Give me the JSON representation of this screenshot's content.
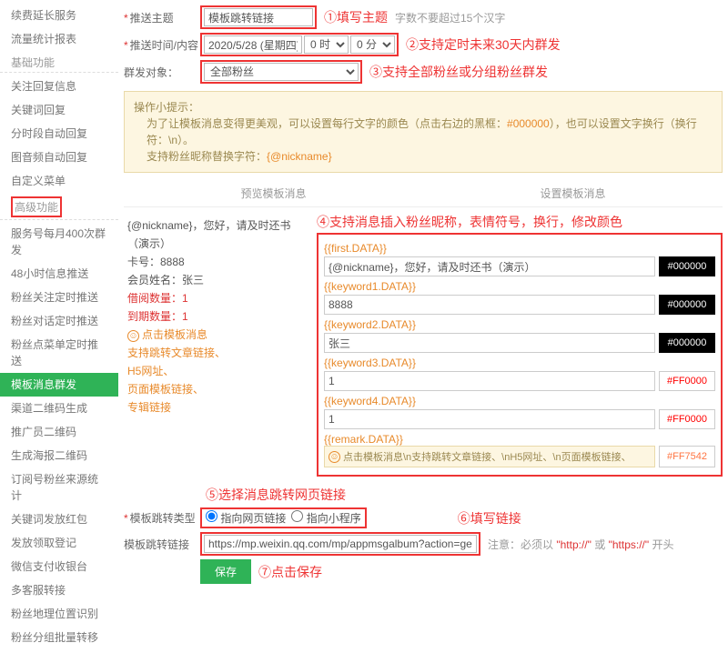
{
  "sidebar": {
    "groups": [
      {
        "title": "",
        "items": [
          "续费延长服务",
          "流量统计报表"
        ]
      },
      {
        "title": "基础功能",
        "items": [
          "关注回复信息",
          "关键词回复",
          "分时段自动回复",
          "图音频自动回复",
          "自定义菜单"
        ]
      },
      {
        "title": "高级功能",
        "items": [
          "服务号每月400次群发",
          "48小时信息推送",
          "粉丝关注定时推送",
          "粉丝对话定时推送",
          "粉丝点菜单定时推送",
          "模板消息群发",
          "渠道二维码生成",
          "推广员二维码",
          "生成海报二维码",
          "订阅号粉丝来源统计",
          "关键词发放红包",
          "发放领取登记",
          "微信支付收银台",
          "多客服转接",
          "粉丝地理位置识别",
          "粉丝分组批量转移"
        ],
        "activeIndex": 5,
        "boxedTitle": true
      }
    ]
  },
  "form": {
    "subject": {
      "label": "推送主题",
      "value": "模板跳转链接",
      "hint": "字数不要超过15个汉字"
    },
    "time": {
      "label": "推送时间/内容",
      "date": "2020/5/28 (星期四)",
      "hour": "0 时",
      "min": "0 分"
    },
    "target": {
      "label": "群发对象",
      "value": "全部粉丝"
    },
    "ann1": "①填写主题",
    "ann2": "②支持定时未来30天内群发",
    "ann3": "③支持全部粉丝或分组粉丝群发"
  },
  "tips": {
    "title": "操作小提示：",
    "l1_a": "为了让模板消息变得更美观，可以设置每行文字的颜色（点击右边的黑框：",
    "l1_b": "#000000",
    "l1_c": "），也可以设置文字换行（换行符：\\n）。",
    "l2_a": "支持粉丝昵称替换字符：",
    "l2_b": "{@nickname}"
  },
  "tabs": {
    "t1": "预览模板消息",
    "t2": "设置模板消息"
  },
  "preview": {
    "l1": "{@nickname}，您好，请及时还书（演示）",
    "l2": "卡号：8888",
    "l3": "会员姓名：张三",
    "l4": "借阅数量：1",
    "l5": "到期数量：1",
    "link_icon": "☺",
    "link1": "点击模板消息",
    "link2": "支持跳转文章链接、",
    "link3": "H5网址、",
    "link4": "页面模板链接、",
    "link5": "专辑链接"
  },
  "ann4": "④支持消息插入粉丝昵称，表情符号，换行，修改颜色",
  "fields": [
    {
      "name": "{{first.DATA}}",
      "value": "{@nickname}，您好，请及时还书（演示）",
      "color": "#000000",
      "cls": "blk"
    },
    {
      "name": "{{keyword1.DATA}}",
      "value": "8888",
      "color": "#000000",
      "cls": "blk"
    },
    {
      "name": "{{keyword2.DATA}}",
      "value": "张三",
      "color": "#000000",
      "cls": "blk"
    },
    {
      "name": "{{keyword3.DATA}}",
      "value": "1",
      "color": "#FF0000",
      "cls": "red"
    },
    {
      "name": "{{keyword4.DATA}}",
      "value": "1",
      "color": "#FF0000",
      "cls": "red"
    },
    {
      "name": "{{remark.DATA}}",
      "value": "点击模板消息\\n支持跳转文章链接、\\nH5网址、\\n页面模板链接、",
      "color": "#FF7542",
      "cls": "oran",
      "remark": true
    }
  ],
  "bottom": {
    "ann5": "⑤选择消息跳转网页链接",
    "typeLabel": "模板跳转类型",
    "r1": "指向网页链接",
    "r2": "指向小程序",
    "ann6": "⑥填写链接",
    "urlLabel": "模板跳转链接",
    "url": "https://mp.weixin.qq.com/mp/appmsgalbum?action=getalbum&",
    "urlHint_a": "注意：必须以",
    "urlHint_b": "\"http://\"",
    "urlHint_c": "或",
    "urlHint_d": "\"https://\"",
    "urlHint_e": "开头",
    "save": "保存",
    "ann7": "⑦点击保存"
  }
}
